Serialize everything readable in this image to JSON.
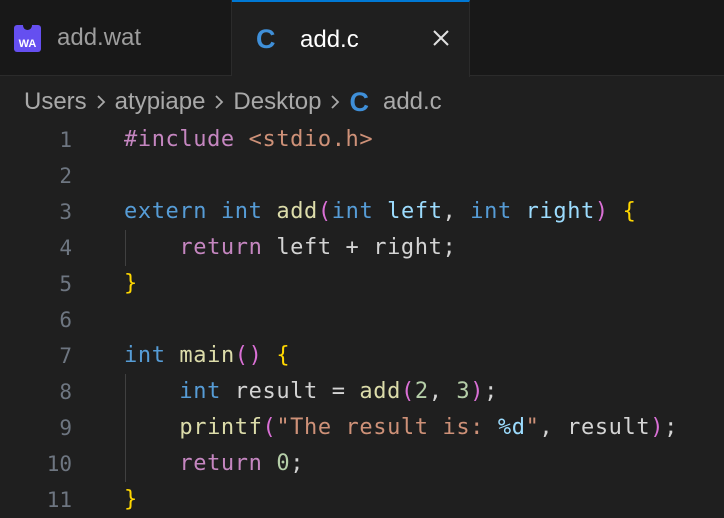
{
  "tabs": [
    {
      "label": "add.wat",
      "icon": "webassembly-icon",
      "icon_text": "WA",
      "active": false
    },
    {
      "label": "add.c",
      "icon": "c-language-icon",
      "icon_text": "C",
      "active": true
    }
  ],
  "breadcrumb": {
    "items": [
      "Users",
      "atypiape",
      "Desktop"
    ],
    "file_icon_text": "C",
    "file": "add.c"
  },
  "editor": {
    "line_numbers": [
      "1",
      "2",
      "3",
      "4",
      "5",
      "6",
      "7",
      "8",
      "9",
      "10",
      "11"
    ],
    "tokens": {
      "l1_include": "#include",
      "l1_header": "<stdio.h>",
      "l3_extern": "extern",
      "l3_int1": "int",
      "l3_fn": "add",
      "l3_int2": "int",
      "l3_left": "left",
      "l3_int3": "int",
      "l3_right": "right",
      "l4_return": "return",
      "l4_expr": "left + right;",
      "l7_int": "int",
      "l7_fn": "main",
      "l8_int": "int",
      "l8_var": "result",
      "l8_eq": " = ",
      "l8_fn": "add",
      "l8_a": "2",
      "l8_b": "3",
      "l9_fn": "printf",
      "l9_str1": "\"The result is: ",
      "l9_fmt": "%d",
      "l9_str2": "\"",
      "l9_arg": "result",
      "l10_return": "return",
      "l10_val": "0"
    },
    "colors": {
      "keyword": "#569cd6",
      "control": "#c586c0",
      "function": "#dcdcaa",
      "variable": "#9cdcfe",
      "string": "#ce9178",
      "number": "#b5cea8",
      "bracket_level1": "#ffd700",
      "bracket_level2": "#da70d6",
      "accent": "#0078d4"
    }
  }
}
